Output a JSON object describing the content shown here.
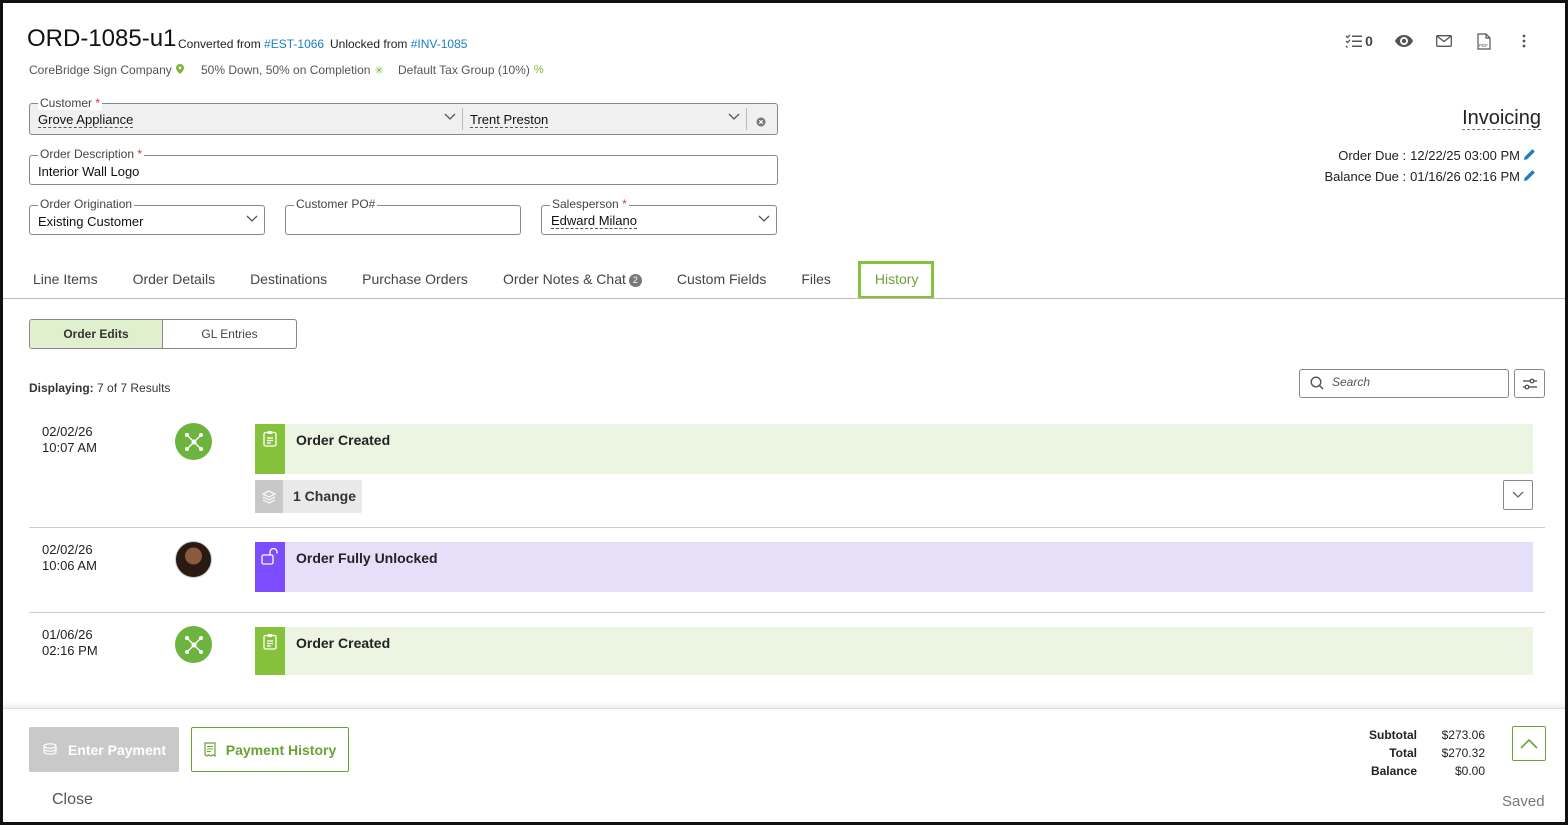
{
  "header": {
    "order_id": "ORD-1085-u1",
    "converted_label": "Converted from",
    "converted_link": "#EST-1066",
    "unlocked_label": "Unlocked from",
    "unlocked_link": "#INV-1085",
    "company": "CoreBridge Sign Company",
    "payment_terms": "50% Down, 50% on Completion",
    "tax_group": "Default Tax Group (10%)",
    "task_count": "0"
  },
  "form": {
    "customer_label": "Customer",
    "customer_value": "Grove Appliance",
    "contact_value": "Trent Preston",
    "description_label": "Order Description",
    "description_value": "Interior Wall Logo",
    "origination_label": "Order Origination",
    "origination_value": "Existing Customer",
    "po_label": "Customer PO#",
    "po_value": "",
    "salesperson_label": "Salesperson",
    "salesperson_value": "Edward Milano",
    "required_mark": "*"
  },
  "status": {
    "title": "Invoicing",
    "order_due_label": "Order Due :",
    "order_due_value": "12/22/25 03:00 PM",
    "balance_due_label": "Balance Due :",
    "balance_due_value": "01/16/26 02:16 PM"
  },
  "tabs": [
    {
      "label": "Line Items"
    },
    {
      "label": "Order Details"
    },
    {
      "label": "Destinations"
    },
    {
      "label": "Purchase Orders"
    },
    {
      "label": "Order Notes & Chat",
      "badge": "2"
    },
    {
      "label": "Custom Fields"
    },
    {
      "label": "Files"
    },
    {
      "label": "History",
      "active": true
    }
  ],
  "history": {
    "segments": [
      "Order Edits",
      "GL Entries"
    ],
    "displaying_label": "Displaying:",
    "displaying_value": "7 of 7 Results",
    "search_placeholder": "Search",
    "entries": [
      {
        "date": "02/02/26",
        "time": "10:07 AM",
        "title": "Order Created",
        "kind": "system",
        "color": "#86c13b"
      },
      {
        "date": "02/02/26",
        "time": "10:06 AM",
        "title": "Order Fully Unlocked",
        "kind": "user",
        "color": "#7c4dff"
      },
      {
        "date": "01/06/26",
        "time": "02:16 PM",
        "title": "Order Created",
        "kind": "system",
        "color": "#86c13b"
      }
    ],
    "change_label": "1 Change"
  },
  "footer": {
    "enter_payment": "Enter Payment",
    "payment_history": "Payment History",
    "close": "Close",
    "saved": "Saved",
    "subtotal_label": "Subtotal",
    "subtotal_value": "$273.06",
    "total_label": "Total",
    "total_value": "$270.32",
    "balance_label": "Balance",
    "balance_value": "$0.00"
  },
  "colors": {
    "accent_green": "#86c13b",
    "link_blue": "#1a7fc1",
    "purple": "#7c4dff"
  }
}
